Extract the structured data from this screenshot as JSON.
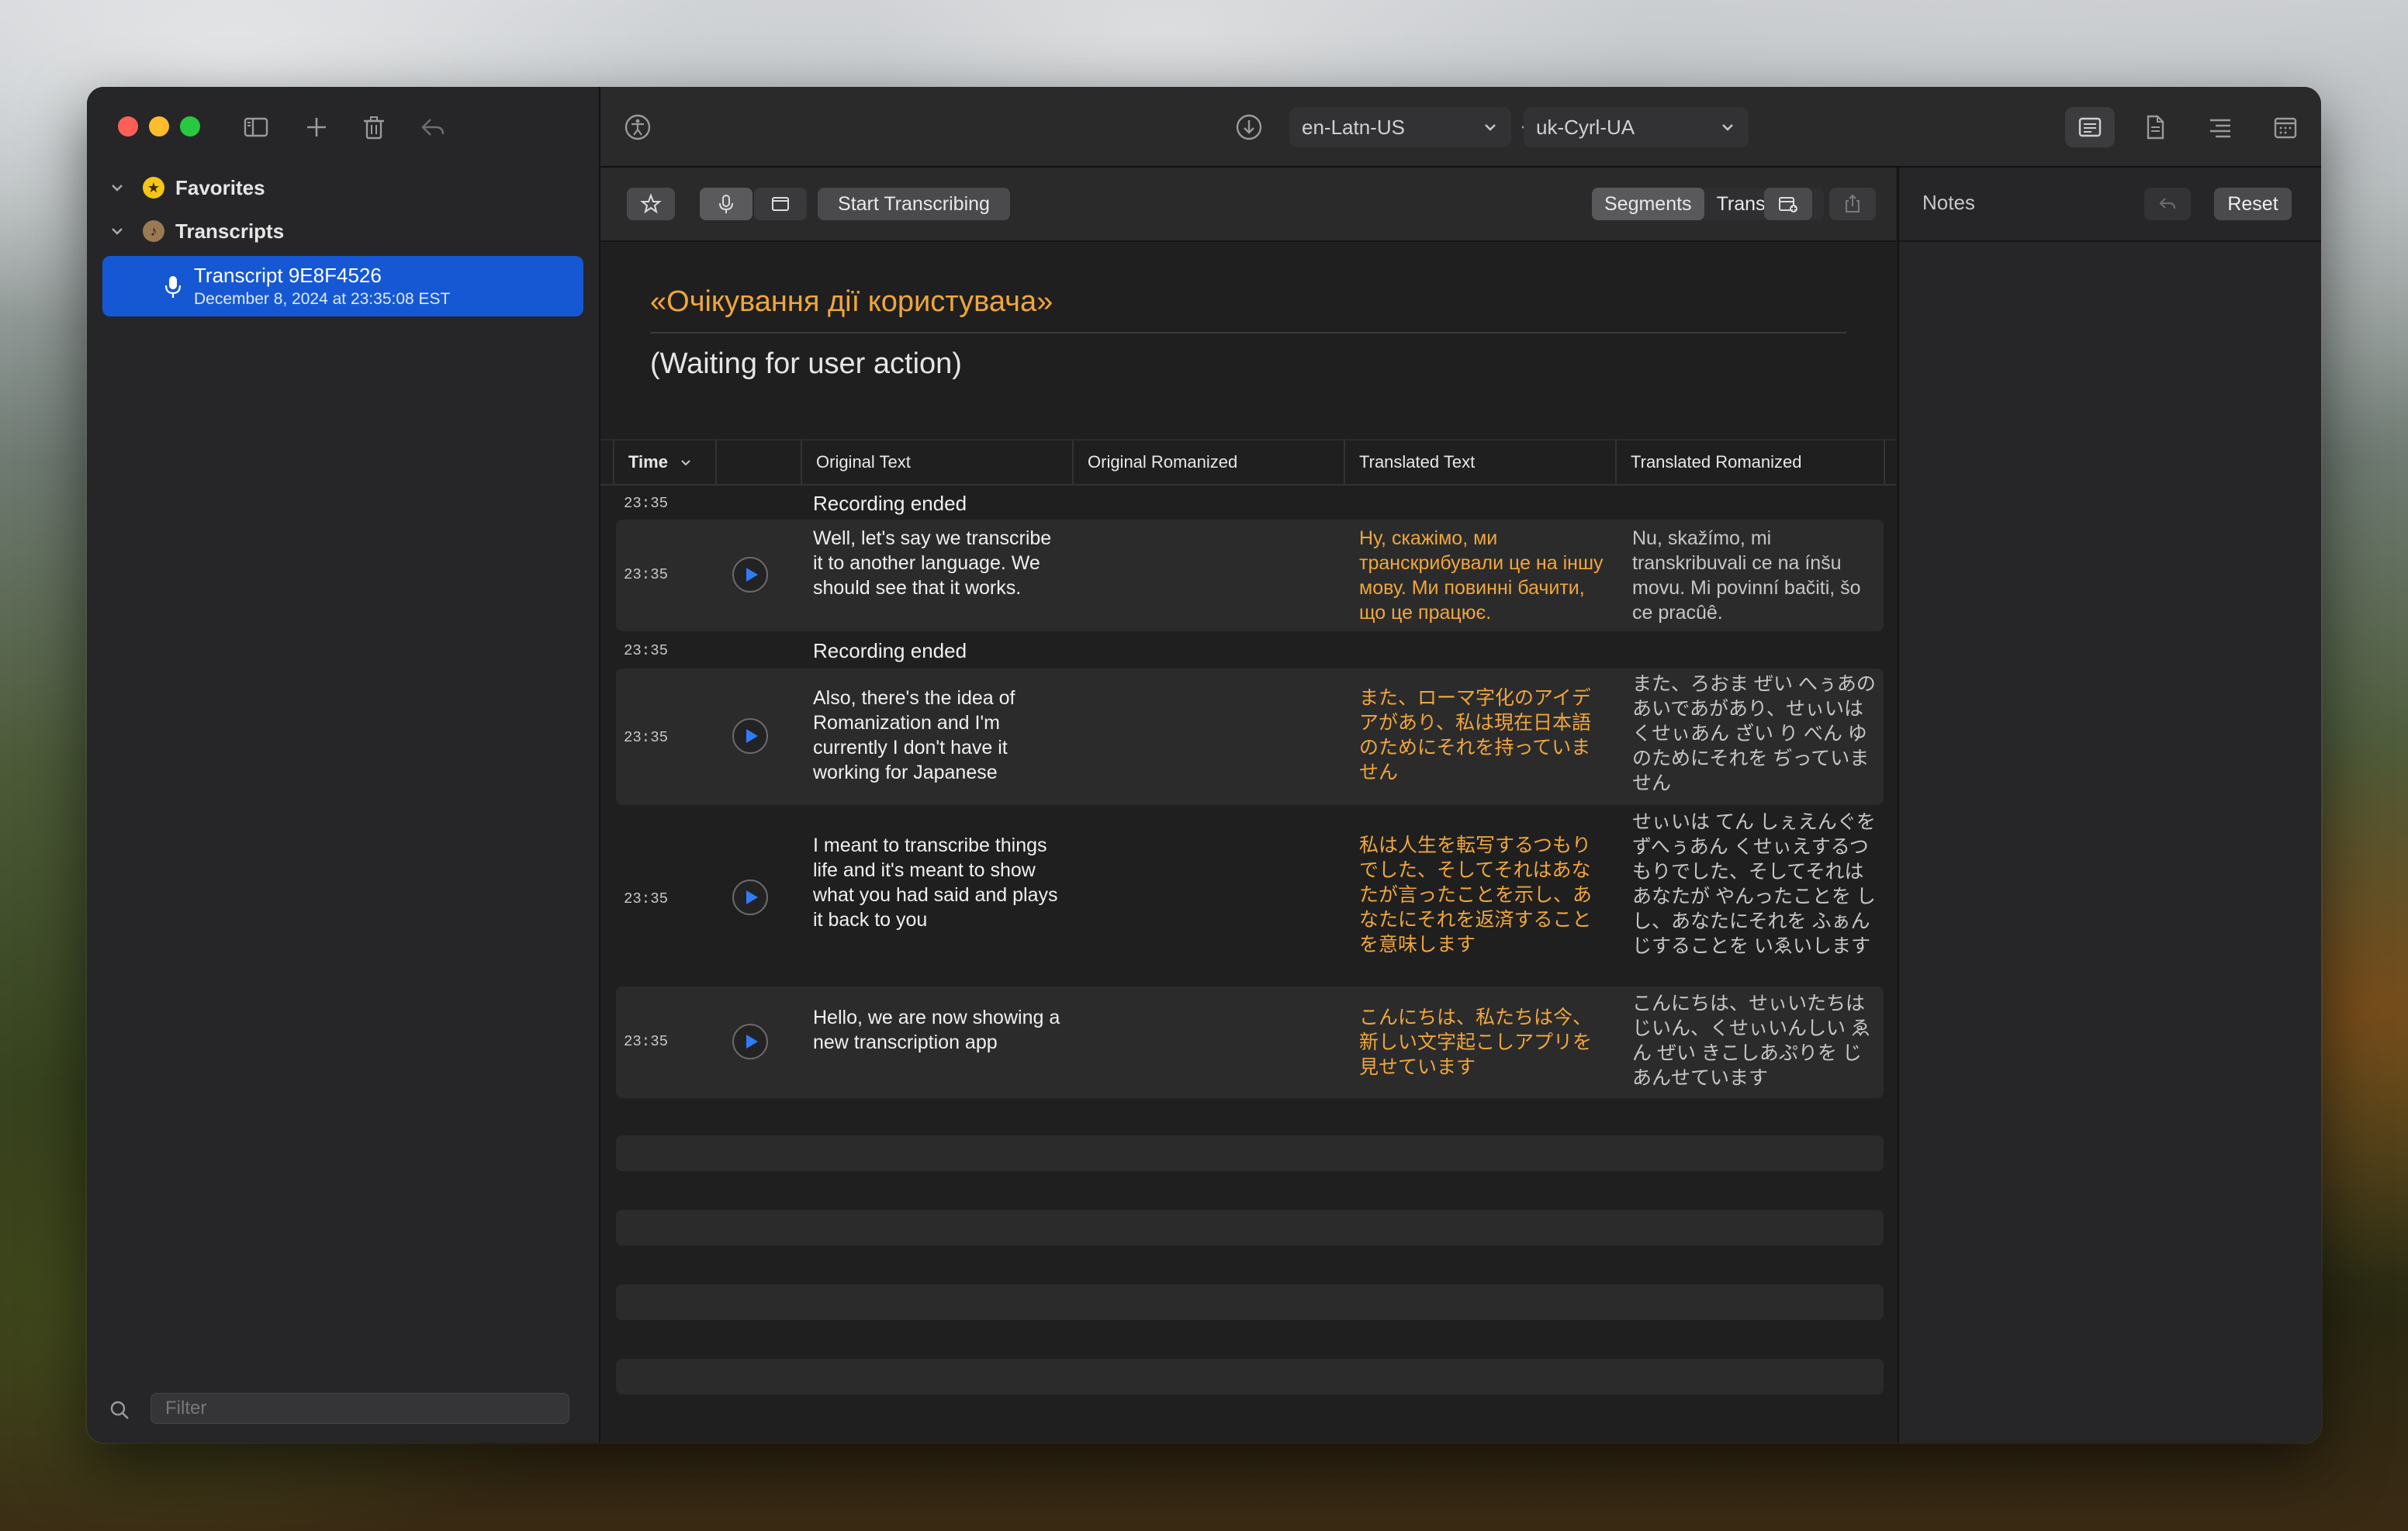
{
  "sidebar": {
    "sections": [
      {
        "label": "Favorites",
        "icon": "star-icon",
        "color": "#f5c518"
      },
      {
        "label": "Transcripts",
        "icon": "transcript-icon",
        "color": "#9a7a55"
      }
    ],
    "selected_item": {
      "title": "Transcript 9E8F4526",
      "subtitle": "December 8, 2024 at 23:35:08 EST"
    },
    "filter_placeholder": "Filter"
  },
  "toolbar": {
    "source_language": "en-Latn-US",
    "target_language": "uk-Cyrl-UA"
  },
  "subbar": {
    "start_label": "Start Transcribing",
    "segments_label": "Segments",
    "transcripts_label": "Transcripts"
  },
  "header": {
    "translated": "«Очікування дії користувача»",
    "original": "(Waiting for user action)"
  },
  "table": {
    "columns": [
      "Time",
      "Original Text",
      "Original Romanized",
      "Translated Text",
      "Translated Romanized"
    ],
    "rows": [
      {
        "time": "23:35",
        "event": "Recording ended"
      },
      {
        "time": "23:35",
        "original": "Well, let's say we transcribe it to another language. We should see that it works.",
        "translated": "Ну, скажімо, ми транскрибували це на іншу мову. Ми повинні бачити, що це працює.",
        "romanized": "Nu, skažímo, mi transkribuvali ce na ínšu movu. Mi povinní bačiti, šo ce pracûê."
      },
      {
        "time": "23:35",
        "event": "Recording ended"
      },
      {
        "time": "23:35",
        "original": "Also, there's the idea of Romanization and I'm currently I don't have it working for Japanese",
        "translated": "また、ローマ字化のアイデアがあり、私は現在日本語のためにそれを持っていません",
        "romanized": "また、ろおま ぜい へぅあのあいであがあり、せぃいは くせぃあん ざい り べん ゆのためにそれを ぢっていません"
      },
      {
        "time": "23:35",
        "original": "I meant to transcribe things life and it's meant to show what you had said and plays it back to you",
        "translated": "私は人生を転写するつもりでした、そしてそれはあなたが言ったことを示し、あなたにそれを返済することを意味します",
        "romanized": "せぃいは てん しぇえんぐを ずへぅあん くせぃえするつもりでした、そしてそれはあなたが やんったことを しし、あなたにそれを ふぁん じすることを いゑいします"
      },
      {
        "time": "23:35",
        "original": "Hello, we are now showing a new transcription app",
        "translated": "こんにちは、私たちは今、新しい文字起こしアプリを見せています",
        "romanized": "こんにちは、せぃいたちは じいん、くせぃいんしい ゑん ぜい きこしあぷりを じあんせています"
      }
    ]
  },
  "notes": {
    "title": "Notes",
    "reset_label": "Reset"
  },
  "colors": {
    "accent": "#1658d4",
    "translated_text": "#f0a63c",
    "play_icon": "#2f7cf6"
  }
}
